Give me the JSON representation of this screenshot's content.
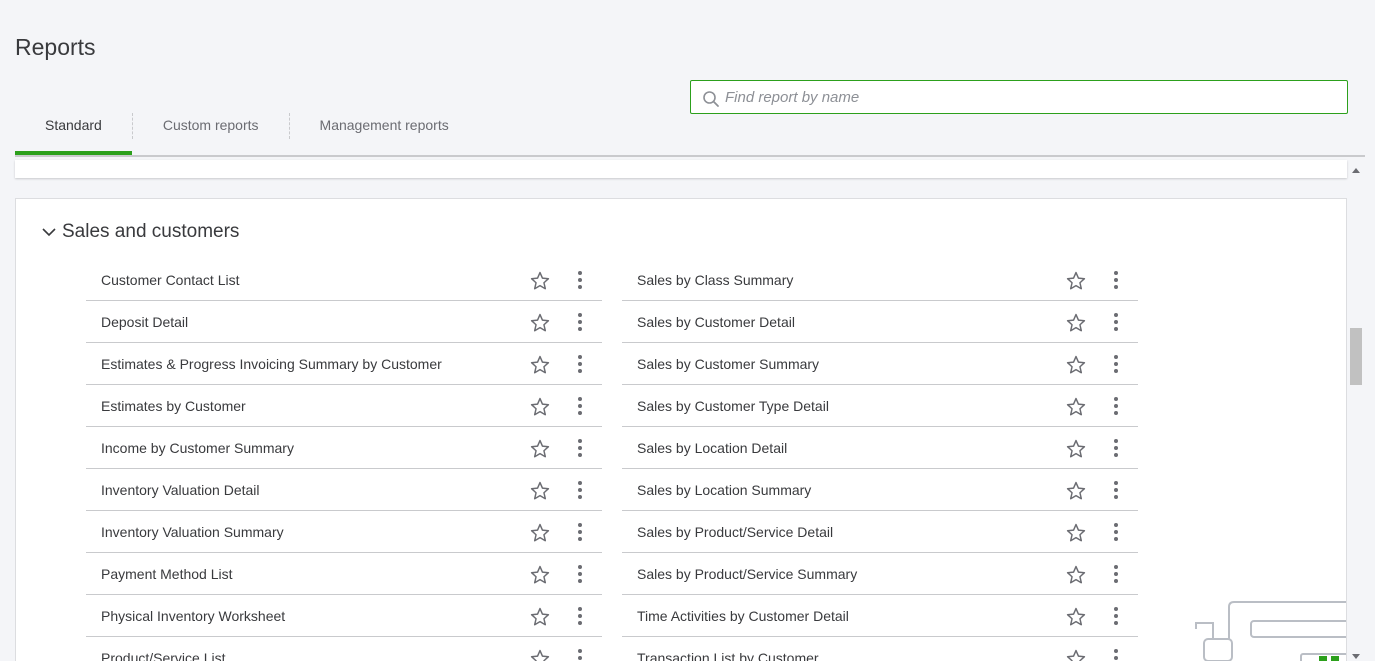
{
  "page": {
    "title": "Reports"
  },
  "tabs": [
    {
      "label": "Standard",
      "active": true
    },
    {
      "label": "Custom reports",
      "active": false
    },
    {
      "label": "Management reports",
      "active": false
    }
  ],
  "search": {
    "placeholder": "Find report by name",
    "value": ""
  },
  "section": {
    "title": "Sales and customers",
    "expanded": true
  },
  "reports_left": [
    "Customer Contact List",
    "Deposit Detail",
    "Estimates & Progress Invoicing Summary by Customer",
    "Estimates by Customer",
    "Income by Customer Summary",
    "Inventory Valuation Detail",
    "Inventory Valuation Summary",
    "Payment Method List",
    "Physical Inventory Worksheet",
    "Product/Service List"
  ],
  "reports_right": [
    "Sales by Class Summary",
    "Sales by Customer Detail",
    "Sales by Customer Summary",
    "Sales by Customer Type Detail",
    "Sales by Location Detail",
    "Sales by Location Summary",
    "Sales by Product/Service Detail",
    "Sales by Product/Service Summary",
    "Time Activities by Customer Detail",
    "Transaction List by Customer"
  ],
  "icons": {
    "search": "search-icon",
    "chevron": "chevron-down-icon",
    "favorite": "star-outline-icon",
    "more": "more-vertical-icon"
  },
  "colors": {
    "accent": "#2ca01c",
    "text": "#393a3d",
    "muted": "#6b6c72",
    "background": "#f4f5f8"
  }
}
